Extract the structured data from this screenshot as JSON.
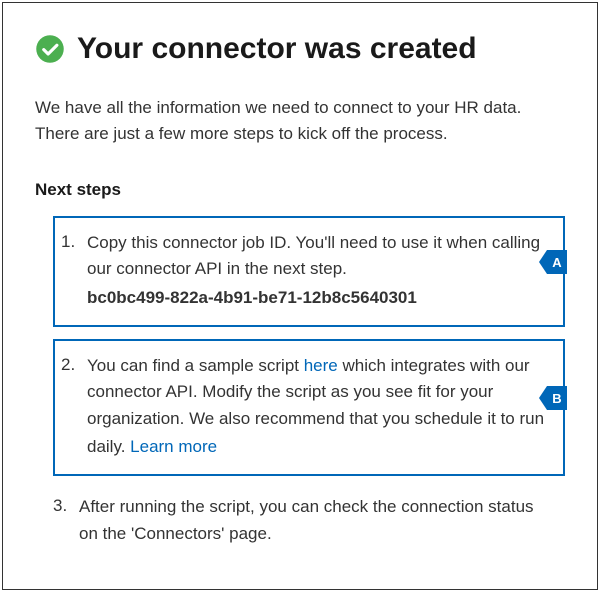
{
  "header": {
    "title": "Your connector was created"
  },
  "description": "We have all the information we need to connect to your HR data. There are just a few more steps to kick off the process.",
  "nextStepsHeading": "Next steps",
  "steps": {
    "step1": {
      "text": "Copy this connector job ID. You'll need to use it when calling our connector API in the next step.",
      "jobId": "bc0bc499-822a-4b91-be71-12b8c5640301"
    },
    "step2": {
      "textBefore": "You can find a sample script ",
      "linkText": "here",
      "textAfter": " which integrates with our connector API. Modify the script as you see fit for your organization. We also recommend that you schedule it to run daily. ",
      "learnMore": "Learn more"
    },
    "step3": {
      "text": "After running the script, you can check the connection status on the 'Connectors' page."
    }
  },
  "callouts": {
    "a": "A",
    "b": "B"
  }
}
